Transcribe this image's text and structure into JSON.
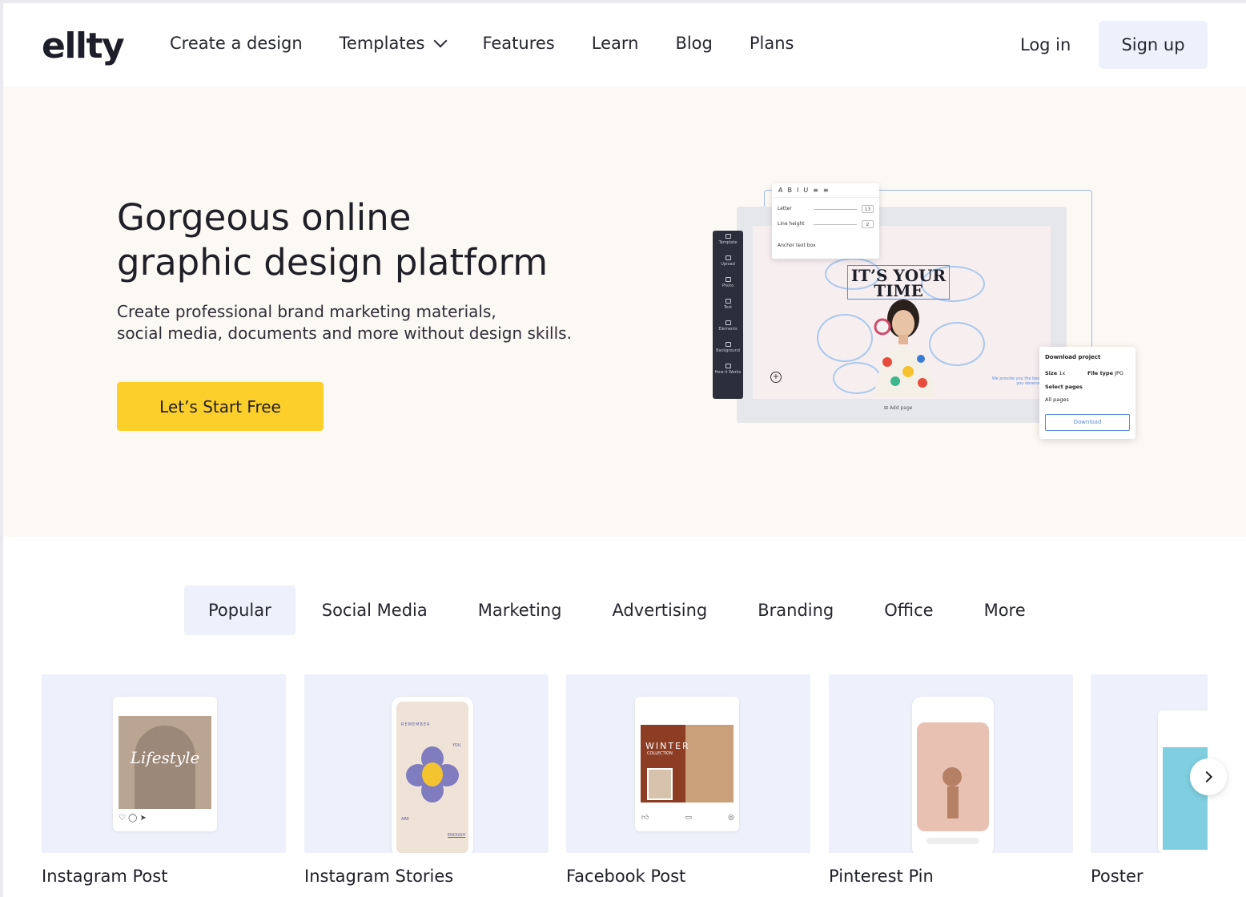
{
  "brand": {
    "logo": "ellty"
  },
  "nav": {
    "items": [
      {
        "label": "Create a design",
        "dropdown": false
      },
      {
        "label": "Templates",
        "dropdown": true
      },
      {
        "label": "Features",
        "dropdown": false
      },
      {
        "label": "Learn",
        "dropdown": false
      },
      {
        "label": "Blog",
        "dropdown": false
      },
      {
        "label": "Plans",
        "dropdown": false
      }
    ],
    "login": "Log in",
    "signup": "Sign up"
  },
  "hero": {
    "title_line1": "Gorgeous online",
    "title_line2": "graphic design platform",
    "subtitle_line1": "Create professional brand marketing materials,",
    "subtitle_line2": "social media, documents and more without design skills.",
    "cta": "Let’s Start Free"
  },
  "mockup": {
    "sidebar": [
      "Template",
      "Upload",
      "Photo",
      "Text",
      "Elements",
      "Background",
      "How it Works"
    ],
    "toolbar_letter": "Letter",
    "toolbar_letter_value": "13",
    "toolbar_line_height": "Line height",
    "toolbar_line_height_value": "2",
    "toolbar_anchor": "Anchor text box",
    "canvas_title_line1": "IT’S YOUR",
    "canvas_title_line2": "TIME",
    "canvas_tagline": "We provide you the best you deserve",
    "add_page": "Add page",
    "download_title": "Download project",
    "download_size_label": "Size",
    "download_size_value": "1x",
    "download_filetype_label": "File type",
    "download_filetype_value": "JPG",
    "download_select_pages": "Select pages",
    "download_pages_value": "All pages",
    "download_button": "Download"
  },
  "tabs": {
    "items": [
      "Popular",
      "Social Media",
      "Marketing",
      "Advertising",
      "Branding",
      "Office",
      "More"
    ],
    "active": "Popular"
  },
  "cards": [
    {
      "label": "Instagram Post",
      "thumb_text": "Lifestyle"
    },
    {
      "label": "Instagram Stories",
      "thumb_text_top": "REMEMBER",
      "thumb_text_you": "YOU",
      "thumb_text_are": "ARE",
      "thumb_text_enough": "ENOUGH"
    },
    {
      "label": "Facebook Post",
      "thumb_text": "WINTER",
      "thumb_text_sub": "COLLECTION"
    },
    {
      "label": "Pinterest Pin"
    },
    {
      "label": "Poster"
    }
  ],
  "colors": {
    "accent_yellow": "#fccf2a",
    "hero_bg": "#fcf8f3",
    "tab_active_bg": "#eef1fb",
    "card_bg": "#eef1fb",
    "mock_highlight_blue": "#5b8de0"
  }
}
